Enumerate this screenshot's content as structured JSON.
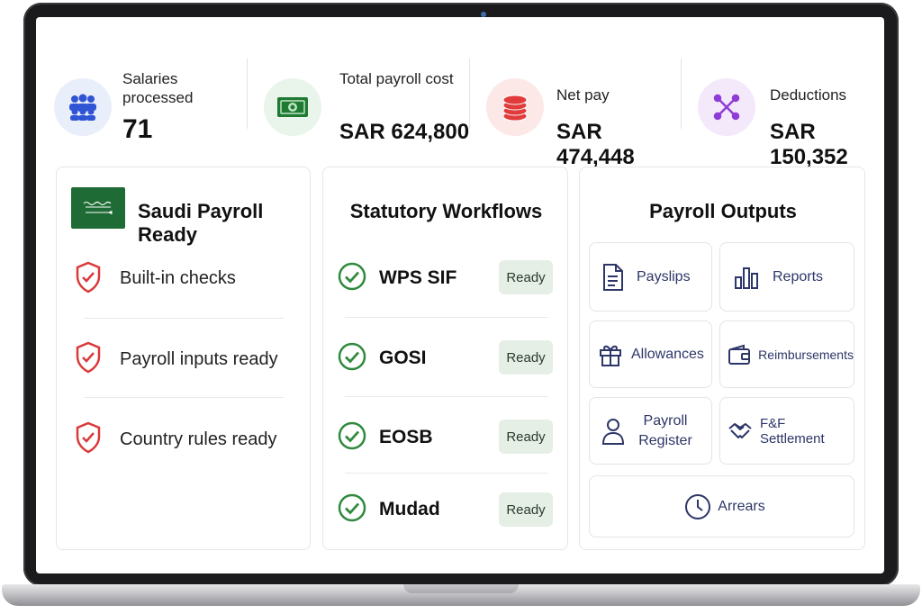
{
  "stats": [
    {
      "label": "Salaries processed",
      "value": "71",
      "icon": "people-icon"
    },
    {
      "label": "Total payroll cost",
      "value": "SAR 624,800",
      "icon": "banknote-icon"
    },
    {
      "label": "Net pay",
      "value": "SAR 474,448",
      "icon": "coins-icon"
    },
    {
      "label": "Deductions",
      "value": "SAR 150,352",
      "icon": "network-icon"
    }
  ],
  "saudi_card": {
    "title": "Saudi Payroll Ready",
    "flag_icon": "saudi-flag-icon",
    "items": [
      {
        "label": "Built-in checks",
        "icon": "shield-check-icon"
      },
      {
        "label": "Payroll inputs ready",
        "icon": "shield-check-icon"
      },
      {
        "label": "Country rules ready",
        "icon": "shield-check-icon"
      }
    ]
  },
  "workflows_card": {
    "title": "Statutory Workflows",
    "items": [
      {
        "name": "WPS SIF",
        "status": "Ready"
      },
      {
        "name": "GOSI",
        "status": "Ready"
      },
      {
        "name": "EOSB",
        "status": "Ready"
      },
      {
        "name": "Mudad",
        "status": "Ready"
      }
    ]
  },
  "outputs_card": {
    "title": "Payroll Outputs",
    "tiles": [
      {
        "label": "Payslips",
        "icon": "document-icon"
      },
      {
        "label": "Reports",
        "icon": "bar-chart-icon"
      },
      {
        "label": "Allowances",
        "icon": "gift-icon"
      },
      {
        "label": "Reimbursements",
        "icon": "wallet-icon"
      },
      {
        "label": "Payroll Register",
        "icon": "person-icon"
      },
      {
        "label": "F&F Settlement",
        "icon": "handshake-icon"
      },
      {
        "label": "Arrears",
        "icon": "clock-icon"
      }
    ]
  },
  "colors": {
    "accent_navy": "#2d3668",
    "check_green": "#2f8a3e",
    "shield_red": "#d93a3a",
    "pill_bg": "#e5efe6"
  }
}
